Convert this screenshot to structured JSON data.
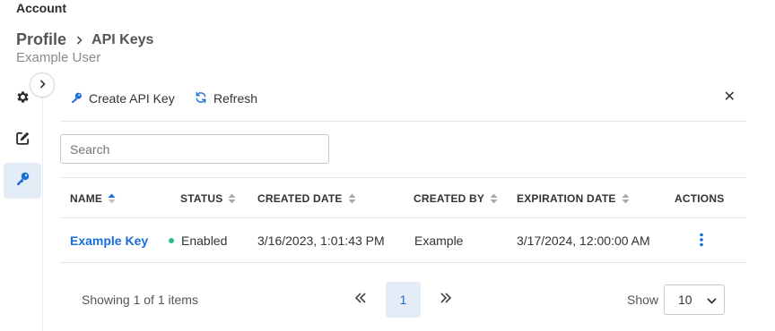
{
  "header": {
    "section": "Account",
    "breadcrumb": {
      "root": "Profile",
      "current": "API Keys"
    },
    "subtitle": "Example User"
  },
  "sidebar": {
    "items": [
      {
        "icon": "gear-icon",
        "active": false
      },
      {
        "icon": "edit-icon",
        "active": false
      },
      {
        "icon": "key-icon",
        "active": true
      }
    ]
  },
  "toolbar": {
    "create_label": "Create API Key",
    "refresh_label": "Refresh",
    "close_glyph": "✕"
  },
  "search": {
    "placeholder": "Search",
    "value": ""
  },
  "table": {
    "columns": [
      "NAME",
      "STATUS",
      "CREATED DATE",
      "CREATED BY",
      "EXPIRATION DATE",
      "ACTIONS"
    ],
    "sorted_column": "NAME",
    "rows": [
      {
        "name": "Example Key",
        "status": "Enabled",
        "created_date": "3/16/2023, 1:01:43 PM",
        "created_by": "Example",
        "expiration_date": "3/17/2024, 12:00:00 AM"
      }
    ]
  },
  "pagination": {
    "info": "Showing 1 of 1 items",
    "current_page": "1",
    "show_label": "Show",
    "page_size": "10"
  },
  "colors": {
    "accent": "#1a6ed8",
    "active_bg": "#e3ecf7",
    "status_enabled": "#2bbd8e"
  }
}
